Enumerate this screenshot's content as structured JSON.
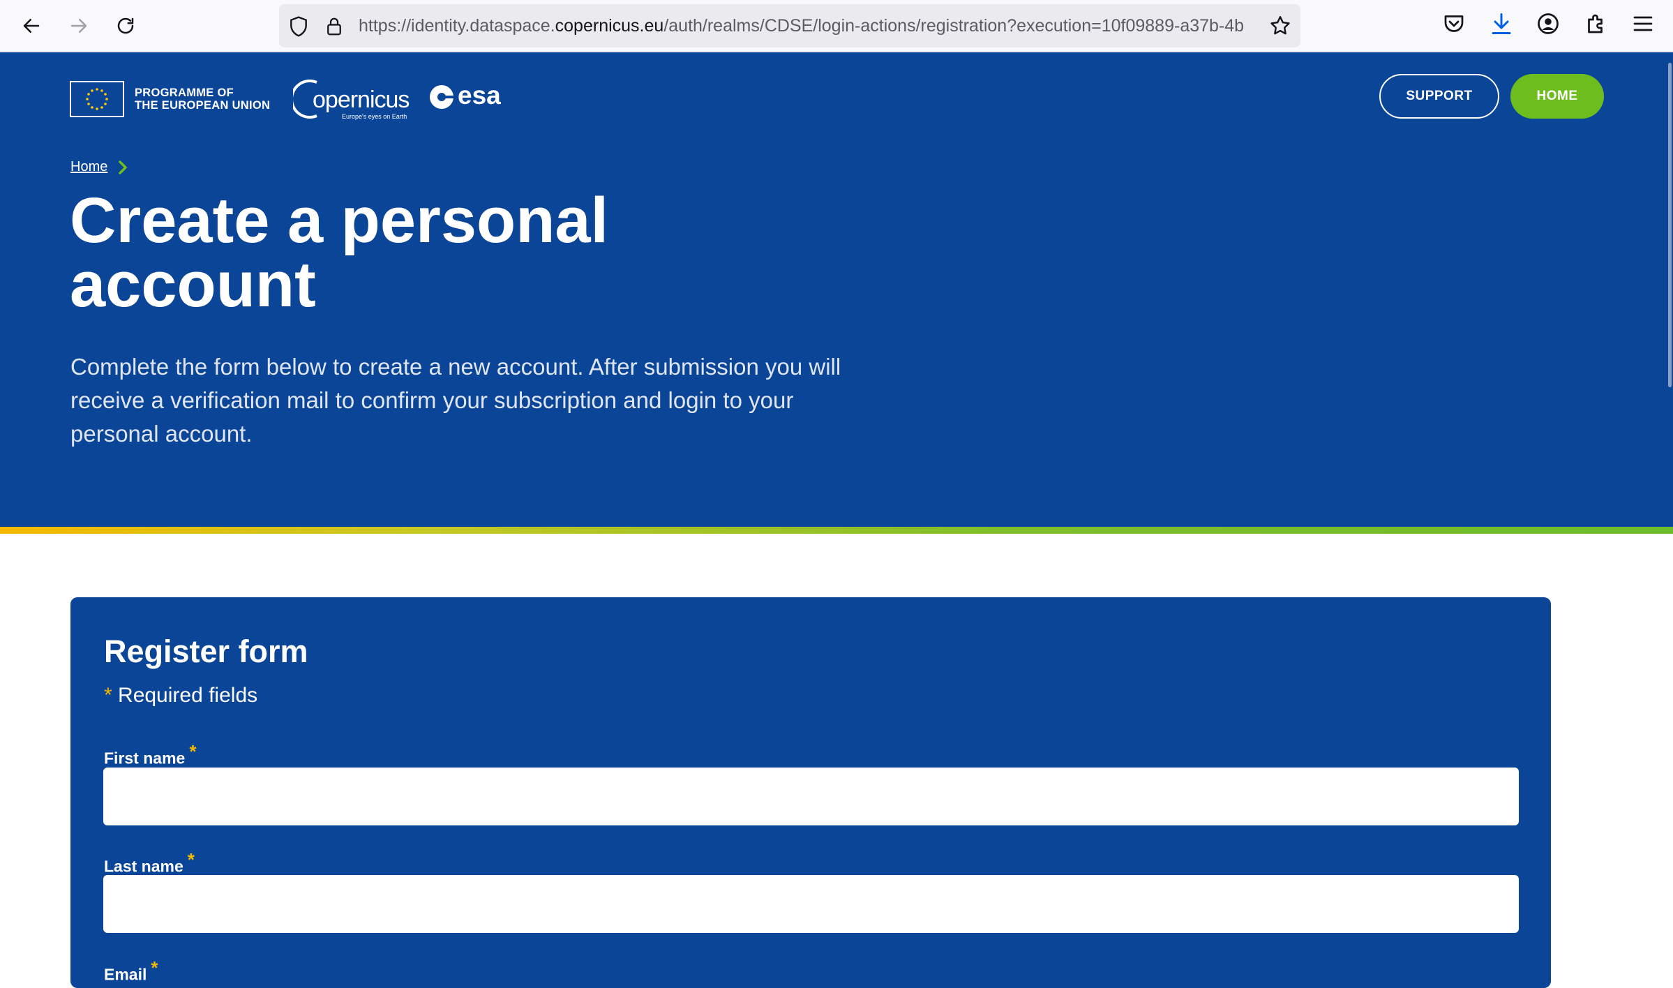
{
  "browser": {
    "url_prefix": "https://identity.dataspace.",
    "url_domain": "copernicus.eu",
    "url_suffix": "/auth/realms/CDSE/login-actions/registration?execution=10f09889-a37b-4b"
  },
  "header": {
    "eu_line1": "PROGRAMME OF",
    "eu_line2": "THE EUROPEAN UNION",
    "copernicus_name": "opernicus",
    "copernicus_tagline": "Europe's eyes on Earth",
    "esa_name": "esa",
    "support_label": "SUPPORT",
    "home_label": "HOME"
  },
  "breadcrumb": {
    "home": "Home"
  },
  "hero": {
    "title": "Create a personal account",
    "intro": "Complete the form below to create a new account. After submission you will receive a verification mail to confirm your subscription and login to your personal account."
  },
  "form": {
    "title": "Register form",
    "required_asterisk": "*",
    "required_note": " Required fields",
    "fields": [
      {
        "label": "First name",
        "value": ""
      },
      {
        "label": "Last name",
        "value": ""
      },
      {
        "label": "Email",
        "value": ""
      }
    ]
  },
  "colors": {
    "brand_blue": "#0b4597",
    "accent_green": "#6ebd1f",
    "required_yellow": "#f5b800"
  }
}
